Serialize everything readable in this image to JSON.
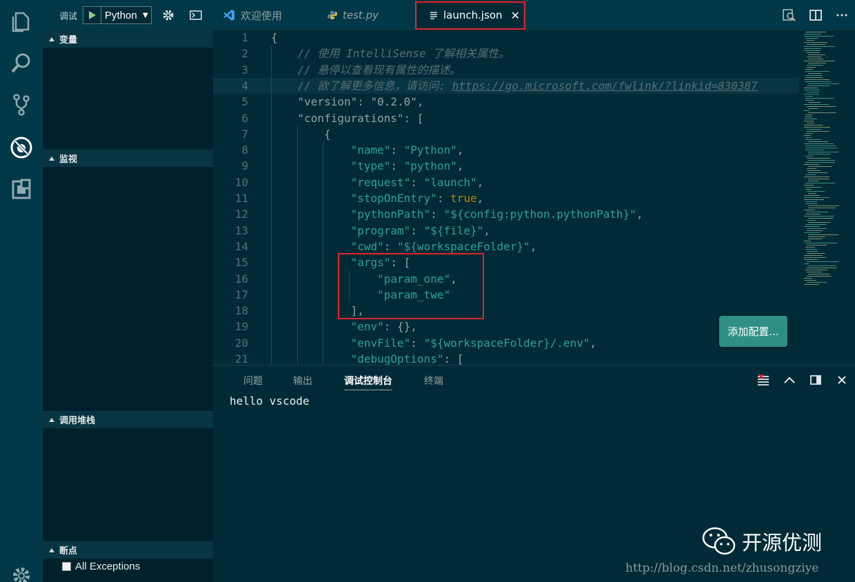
{
  "activity_bar": {
    "icons": [
      "explorer-icon",
      "search-icon",
      "source-control-icon",
      "debug-icon",
      "extensions-icon",
      "settings-gear-icon"
    ]
  },
  "sidebar": {
    "debug_label": "调试",
    "config_name": "Python",
    "sections": {
      "variables": "变量",
      "watch": "监视",
      "call_stack": "调用堆栈",
      "breakpoints": "断点"
    },
    "breakpoint_items": [
      {
        "label": "All Exceptions",
        "checked": false
      }
    ]
  },
  "tabs": [
    {
      "label": "欢迎使用",
      "icon": "vscode-icon",
      "italic": false
    },
    {
      "label": "test.py",
      "icon": "python-icon",
      "italic": true
    },
    {
      "label": "launch.json",
      "icon": "file-lines-icon",
      "active": true,
      "close": "✕"
    }
  ],
  "editor": {
    "lines": [
      {
        "n": "1",
        "seg": [
          [
            "p",
            "{"
          ]
        ]
      },
      {
        "n": "2",
        "seg": [
          [
            "p",
            "    "
          ],
          [
            "c",
            "// 使用 IntelliSense 了解相关属性。"
          ]
        ]
      },
      {
        "n": "3",
        "seg": [
          [
            "p",
            "    "
          ],
          [
            "c",
            "// 悬停以查看现有属性的描述。"
          ]
        ]
      },
      {
        "n": "4",
        "seg": [
          [
            "p",
            "    "
          ],
          [
            "c",
            "// 欲了解更多信息，请访问: "
          ],
          [
            "u",
            "https://go.microsoft.com/fwlink/?linkid=830387"
          ]
        ],
        "current": true
      },
      {
        "n": "5",
        "seg": [
          [
            "p",
            "    \"version\": \"0.2.0\","
          ]
        ]
      },
      {
        "n": "6",
        "seg": [
          [
            "p",
            "    \"configurations\": ["
          ]
        ]
      },
      {
        "n": "7",
        "seg": [
          [
            "p",
            "        {"
          ]
        ]
      },
      {
        "n": "8",
        "seg": [
          [
            "p",
            "            "
          ],
          [
            "k",
            "\"name\""
          ],
          [
            "p",
            ": "
          ],
          [
            "s",
            "\"Python\""
          ],
          [
            "p",
            ","
          ]
        ]
      },
      {
        "n": "9",
        "seg": [
          [
            "p",
            "            "
          ],
          [
            "k",
            "\"type\""
          ],
          [
            "p",
            ": "
          ],
          [
            "s",
            "\"python\""
          ],
          [
            "p",
            ","
          ]
        ]
      },
      {
        "n": "10",
        "seg": [
          [
            "p",
            "            "
          ],
          [
            "k",
            "\"request\""
          ],
          [
            "p",
            ": "
          ],
          [
            "s",
            "\"launch\""
          ],
          [
            "p",
            ","
          ]
        ]
      },
      {
        "n": "11",
        "seg": [
          [
            "p",
            "            "
          ],
          [
            "k",
            "\"stopOnEntry\""
          ],
          [
            "p",
            ": "
          ],
          [
            "kw",
            "true"
          ],
          [
            "p",
            ","
          ]
        ]
      },
      {
        "n": "12",
        "seg": [
          [
            "p",
            "            "
          ],
          [
            "k",
            "\"pythonPath\""
          ],
          [
            "p",
            ": "
          ],
          [
            "s",
            "\"${config:python.pythonPath}\""
          ],
          [
            "p",
            ","
          ]
        ]
      },
      {
        "n": "13",
        "seg": [
          [
            "p",
            "            "
          ],
          [
            "k",
            "\"program\""
          ],
          [
            "p",
            ": "
          ],
          [
            "s",
            "\"${file}\""
          ],
          [
            "p",
            ","
          ]
        ]
      },
      {
        "n": "14",
        "seg": [
          [
            "p",
            "            "
          ],
          [
            "k",
            "\"cwd\""
          ],
          [
            "p",
            ": "
          ],
          [
            "s",
            "\"${workspaceFolder}\""
          ],
          [
            "p",
            ","
          ]
        ]
      },
      {
        "n": "15",
        "seg": [
          [
            "p",
            "            "
          ],
          [
            "k",
            "\"args\""
          ],
          [
            "p",
            ": ["
          ]
        ]
      },
      {
        "n": "16",
        "seg": [
          [
            "p",
            "                "
          ],
          [
            "s",
            "\"param_one\""
          ],
          [
            "p",
            ","
          ]
        ]
      },
      {
        "n": "17",
        "seg": [
          [
            "p",
            "                "
          ],
          [
            "s",
            "\"param_twe\""
          ]
        ]
      },
      {
        "n": "18",
        "seg": [
          [
            "p",
            "            ],"
          ]
        ]
      },
      {
        "n": "19",
        "seg": [
          [
            "p",
            "            "
          ],
          [
            "k",
            "\"env\""
          ],
          [
            "p",
            ": {},"
          ]
        ]
      },
      {
        "n": "20",
        "seg": [
          [
            "p",
            "            "
          ],
          [
            "k",
            "\"envFile\""
          ],
          [
            "p",
            ": "
          ],
          [
            "s",
            "\"${workspaceFolder}/.env\""
          ],
          [
            "p",
            ","
          ]
        ]
      },
      {
        "n": "21",
        "seg": [
          [
            "p",
            "            "
          ],
          [
            "k",
            "\"debugOptions\""
          ],
          [
            "p",
            ": ["
          ]
        ]
      }
    ],
    "add_config_button": "添加配置..."
  },
  "panel": {
    "tabs": [
      "问题",
      "输出",
      "调试控制台",
      "终端"
    ],
    "active_tab": "调试控制台",
    "output": "hello vscode"
  },
  "watermark": {
    "name": "开源优测",
    "url": "http://blog.csdn.net/zhusongziye"
  },
  "colors": {
    "background": "#002b36",
    "activity_bar": "#003847",
    "key": "#2aa198",
    "string": "#2aa198",
    "keyword": "#b58900",
    "comment": "#586e75",
    "highlight_box": "#e0242c",
    "button": "#2f8f85"
  }
}
